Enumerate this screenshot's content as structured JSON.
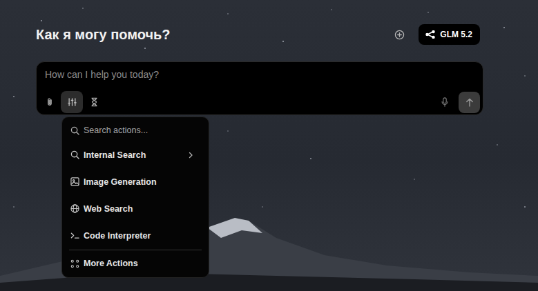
{
  "heading": "Как я могу помочь?",
  "model_badge": {
    "label": "GLM 5.2"
  },
  "composer": {
    "placeholder": "How can I help you today?",
    "tools_open": true
  },
  "actions_menu": {
    "search_placeholder": "Search actions...",
    "items": [
      {
        "label": "Internal Search",
        "has_submenu": true
      },
      {
        "label": "Image Generation",
        "has_submenu": false
      },
      {
        "label": "Web Search",
        "has_submenu": false
      },
      {
        "label": "Code Interpreter",
        "has_submenu": false
      }
    ],
    "more": {
      "label": "More Actions"
    }
  }
}
